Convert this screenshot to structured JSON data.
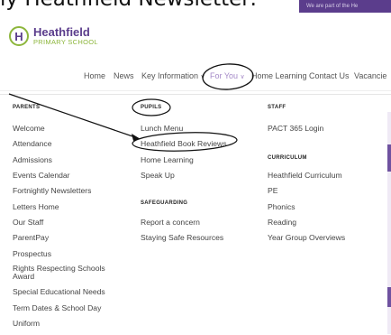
{
  "caption": "ly Heathfield Newsletter:",
  "header": {
    "strap": "We are part of the He"
  },
  "logo": {
    "badge": "H",
    "name": "Heathfield",
    "sub": "PRIMARY SCHOOL"
  },
  "nav": [
    {
      "label": "Home",
      "chev": ""
    },
    {
      "label": "News",
      "chev": ""
    },
    {
      "label": "Key Information",
      "chev": "∨"
    },
    {
      "label": "For You",
      "chev": "∨"
    },
    {
      "label": "Home Learning",
      "chev": ""
    },
    {
      "label": "Contact Us",
      "chev": ""
    },
    {
      "label": "Vacancie",
      "chev": ""
    }
  ],
  "menu": {
    "parents": {
      "title": "PARENTS",
      "items": [
        "Welcome",
        "Attendance",
        "Admissions",
        "Events Calendar",
        "Fortnightly Newsletters",
        "Letters Home",
        "Our Staff",
        "ParentPay",
        "Prospectus",
        "Rights Respecting Schools Award",
        "Special Educational Needs",
        "Term Dates & School Day",
        "Uniform"
      ]
    },
    "pupils": {
      "title": "PUPILS",
      "items": [
        "Lunch Menu",
        "Heathfield Book Reviews",
        "Home Learning",
        "Speak Up"
      ]
    },
    "safeguarding": {
      "title": "SAFEGUARDING",
      "items": [
        "Report a concern",
        "Staying Safe Resources"
      ]
    },
    "staff": {
      "title": "STAFF",
      "items": [
        "PACT 365 Login"
      ]
    },
    "curriculum": {
      "title": "CURRICULUM",
      "items": [
        "Heathfield Curriculum",
        "PE",
        "Phonics",
        "Reading",
        "Year Group Overviews"
      ]
    }
  },
  "colors": {
    "brand_purple": "#5b3d8c",
    "brand_green": "#8db63c",
    "nav_active": "#a58ac8",
    "annotation": "#111111"
  },
  "annotations": {
    "style": "hand-drawn black ink circles and arrow"
  }
}
